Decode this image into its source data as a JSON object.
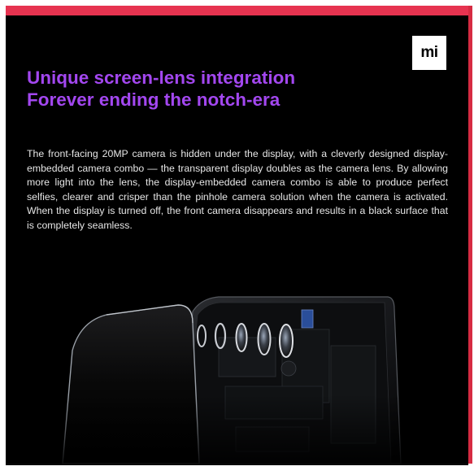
{
  "brand": {
    "logo_text": "mi",
    "accent": "#e63350",
    "headline_color": "#a347f0"
  },
  "headline": {
    "line1": "Unique screen-lens integration",
    "line2": "Forever ending the notch-era"
  },
  "body_text": "The front-facing 20MP camera is hidden under the display, with a cleverly designed display-embedded camera combo — the transparent display doubles as the camera lens. By allowing more light into the lens, the display-embedded camera combo is able to produce perfect selfies, clearer and crisper than the pinhole camera solution when the camera is activated. When the display is turned off, the front camera disappears and results in a black surface that is completely seamless.",
  "illustration": {
    "icon": "exploded-phone-camera-layers"
  }
}
